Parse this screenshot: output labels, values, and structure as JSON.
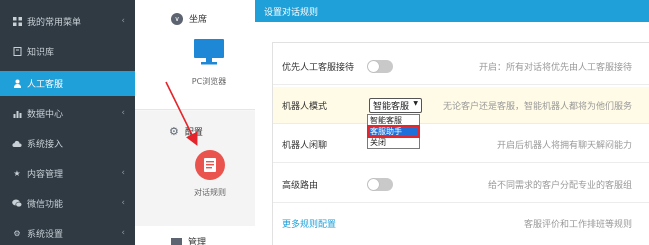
{
  "sidebar": {
    "items": [
      {
        "label": "我的常用菜单",
        "icon": "grid-icon"
      },
      {
        "label": "知识库",
        "icon": "book-icon"
      },
      {
        "label": "人工客服",
        "icon": "user-icon"
      },
      {
        "label": "数据中心",
        "icon": "chart-icon"
      },
      {
        "label": "系统接入",
        "icon": "cloud-icon"
      },
      {
        "label": "内容管理",
        "icon": "star-icon"
      },
      {
        "label": "微信功能",
        "icon": "wechat-icon"
      },
      {
        "label": "系统设置",
        "icon": "gear-icon"
      }
    ],
    "active_index": 2
  },
  "middle": {
    "section1_title": "坐席",
    "pc_label": "PC浏览器",
    "section2_title": "配置",
    "rules_label": "对话规则",
    "section3_title": "管理"
  },
  "modal": {
    "title": "设置对话规则",
    "rows": [
      {
        "label": "优先人工客服接待",
        "desc": "开启：所有对话将优先由人工客服接待",
        "control": "toggle"
      },
      {
        "label": "机器人模式",
        "desc": "无论客户还是客服，智能机器人都将为他们服务",
        "control": "select",
        "value": "智能客服"
      },
      {
        "label": "机器人闲聊",
        "desc": "开启后机器人将拥有聊天解闷能力",
        "control": "toggle"
      },
      {
        "label": "高级路由",
        "desc": "给不同需求的客户分配专业的客服组",
        "control": "toggle"
      }
    ],
    "more_link": "更多规则配置",
    "more_desc": "客服评价和工作排班等规则",
    "dropdown_options": [
      "智能客服",
      "客服助手",
      "关闭"
    ],
    "dropdown_selected": 1
  },
  "colors": {
    "sidebar_bg": "#2f3a43",
    "accent": "#1fa0d8",
    "danger": "#e9544f",
    "highlight_row": "#fffbe6"
  }
}
